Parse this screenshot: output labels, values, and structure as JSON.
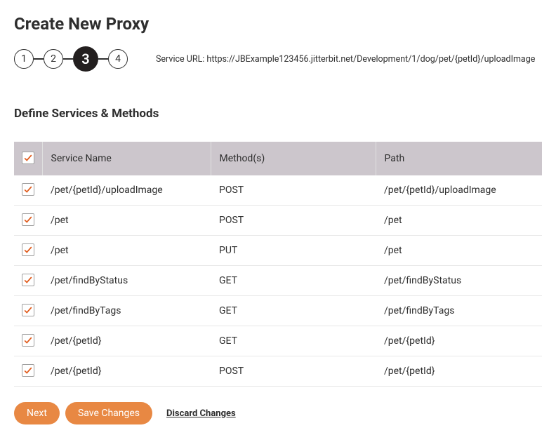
{
  "page": {
    "title": "Create New Proxy"
  },
  "stepper": {
    "steps": [
      "1",
      "2",
      "3",
      "4"
    ],
    "active_index": 2
  },
  "service_url_label": "Service URL: https://JBExample123456.jitterbit.net/Development/1/dog/pet/{petId}/uploadImage",
  "section": {
    "title": "Define Services & Methods"
  },
  "table": {
    "headers": {
      "service_name": "Service Name",
      "methods": "Method(s)",
      "path": "Path"
    },
    "rows": [
      {
        "checked": true,
        "service_name": "/pet/{petId}/uploadImage",
        "method": "POST",
        "path": "/pet/{petId}/uploadImage"
      },
      {
        "checked": true,
        "service_name": "/pet",
        "method": "POST",
        "path": "/pet"
      },
      {
        "checked": true,
        "service_name": "/pet",
        "method": "PUT",
        "path": "/pet"
      },
      {
        "checked": true,
        "service_name": "/pet/findByStatus",
        "method": "GET",
        "path": "/pet/findByStatus"
      },
      {
        "checked": true,
        "service_name": "/pet/findByTags",
        "method": "GET",
        "path": "/pet/findByTags"
      },
      {
        "checked": true,
        "service_name": "/pet/{petId}",
        "method": "GET",
        "path": "/pet/{petId}"
      },
      {
        "checked": true,
        "service_name": "/pet/{petId}",
        "method": "POST",
        "path": "/pet/{petId}"
      }
    ],
    "select_all_checked": true
  },
  "actions": {
    "next": "Next",
    "save": "Save Changes",
    "discard": "Discard Changes"
  },
  "colors": {
    "accent": "#e88843",
    "check": "#e05a1b"
  }
}
